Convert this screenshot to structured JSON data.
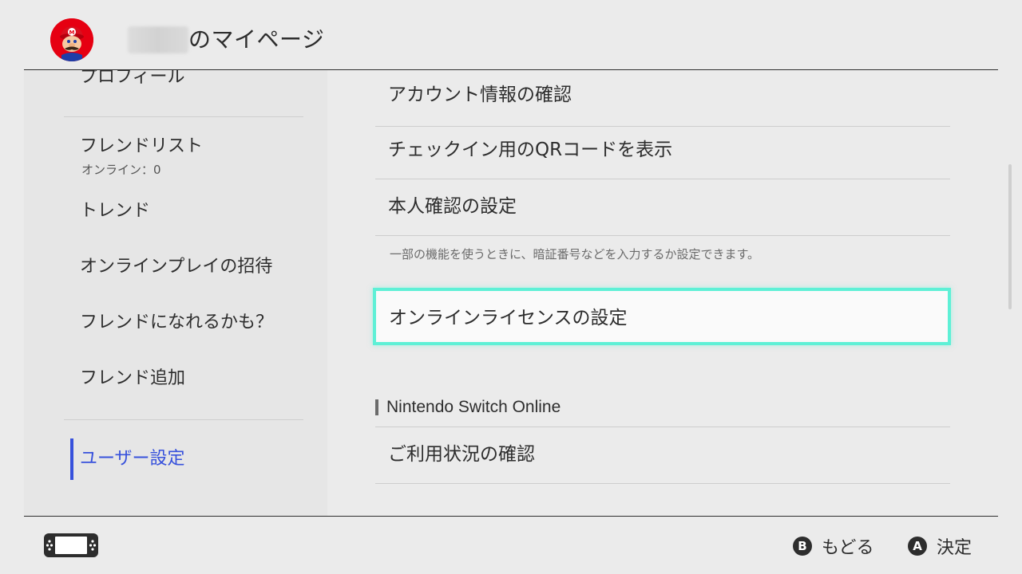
{
  "header": {
    "title": "のマイページ",
    "avatar_icon": "mario-avatar-icon"
  },
  "sidebar": {
    "items": [
      {
        "label": "プロフィール"
      },
      {
        "label": "フレンドリスト",
        "sublabel": "オンライン：0"
      },
      {
        "label": "トレンド"
      },
      {
        "label": "オンラインプレイの招待"
      },
      {
        "label": "フレンドになれるかも？"
      },
      {
        "label": "フレンド追加"
      },
      {
        "label": "ユーザー設定",
        "selected": true
      }
    ],
    "selected_color": "#3751dc"
  },
  "main": {
    "rows": [
      {
        "label": "アカウント情報の確認"
      },
      {
        "label": "チェックイン用のQRコードを表示"
      },
      {
        "label": "本人確認の設定"
      }
    ],
    "note": "一部の機能を使うときに、暗証番号などを入力するか設定できます。",
    "focused_row": {
      "label": "オンラインライセンスの設定"
    },
    "section": {
      "label": "Nintendo Switch Online"
    },
    "section_rows": [
      {
        "label": "ご利用状況の確認"
      }
    ],
    "focus_color": "#5ef0d6"
  },
  "footer": {
    "console_icon": "handheld-console-icon",
    "hints": [
      {
        "button": "B",
        "label": "もどる"
      },
      {
        "button": "A",
        "label": "決定"
      }
    ]
  }
}
